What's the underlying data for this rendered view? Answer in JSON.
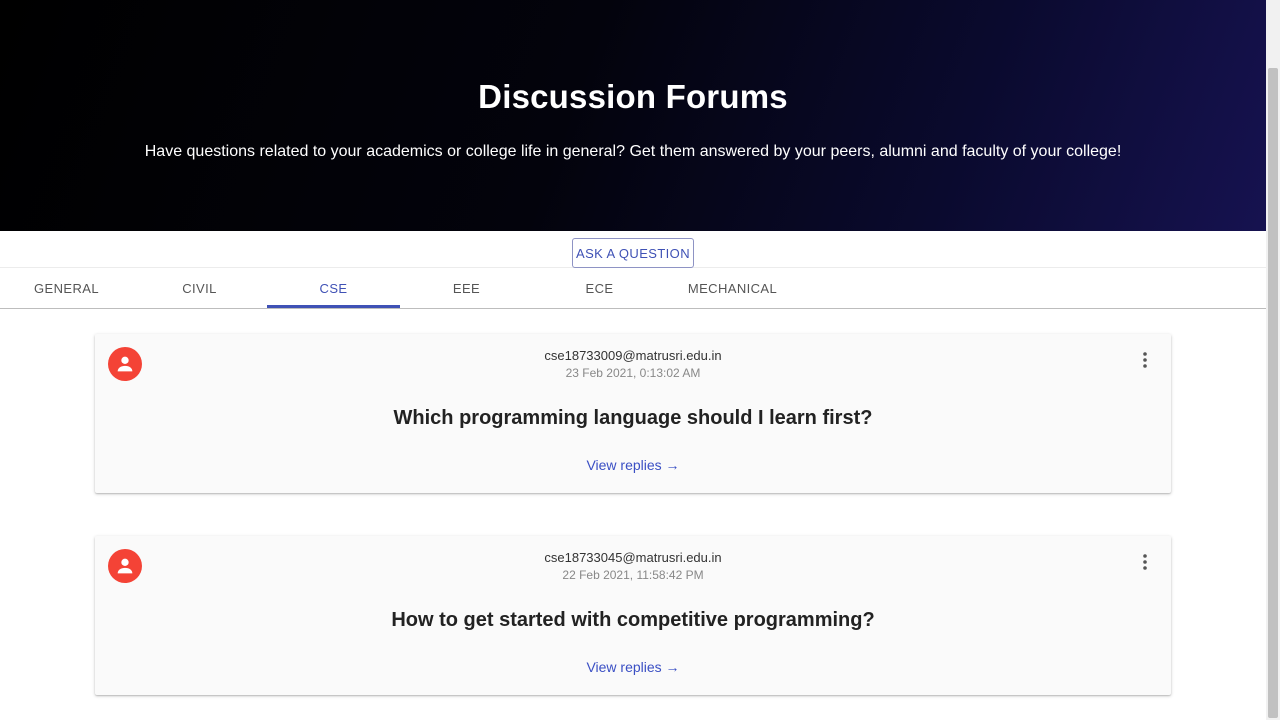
{
  "hero": {
    "title": "Discussion Forums",
    "subtitle": "Have questions related to your academics or college life in general? Get them answered by your peers, alumni and faculty of your college!"
  },
  "ask_button": "ASK A QUESTION",
  "tabs": [
    {
      "label": "GENERAL"
    },
    {
      "label": "CIVIL"
    },
    {
      "label": "CSE"
    },
    {
      "label": "EEE"
    },
    {
      "label": "ECE"
    },
    {
      "label": "MECHANICAL"
    }
  ],
  "active_tab": "CSE",
  "posts": [
    {
      "email": "cse18733009@matrusri.edu.in",
      "date": "23 Feb 2021, 0:13:02 AM",
      "question": "Which programming language should I learn first?",
      "replies_link": "View replies →"
    },
    {
      "email": "cse18733045@matrusri.edu.in",
      "date": "22 Feb 2021, 11:58:42 PM",
      "question": "How to get started with competitive programming?",
      "replies_link": "View replies →"
    }
  ],
  "icons": {
    "avatar": "account-circle-icon",
    "more": "more-vert-icon"
  },
  "colors": {
    "accent": "#3f51b5",
    "avatar": "#f44336",
    "link": "#3a4fc4"
  }
}
